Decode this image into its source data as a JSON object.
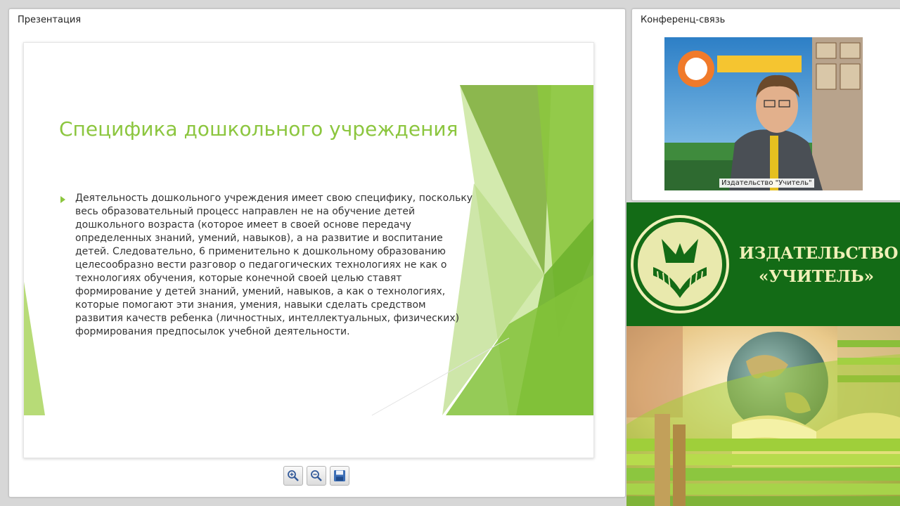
{
  "presentation_panel": {
    "title": "Презентация",
    "slide": {
      "title": "Специфика дошкольного учреждения",
      "body": "Деятельность дошкольного учреждения имеет свою специфику, поскольку весь образовательный процесс направлен не на обучение детей дошкольного возраста (которое имеет в своей основе передачу определенных знаний, умений, навыков), а на развитие и воспитание детей. Следовательно, 6 применительно к дошкольному образованию целесообразно вести разговор о педагогических технологиях не как о технологиях обучения, которые конечной своей целью ставят формирование у детей знаний, умений, навыков, а как о технологиях, которые помогают эти знания, умения, навыки сделать средством развития качеств ребенка (личностных, интеллектуальных, физических) формирования предпосылок учебной деятельности."
    },
    "toolbar": {
      "zoom_in_icon": "zoom-in-icon",
      "zoom_out_icon": "zoom-out-icon",
      "save_icon": "floppy-disk-icon"
    }
  },
  "conference_panel": {
    "title": "Конференц-связь",
    "video_caption": "Издательство \"Учитель\""
  },
  "publisher_banner": {
    "name_line1": "ИЗДАТЕЛЬСТВО",
    "name_line2": "«УЧИТЕЛЬ»"
  },
  "colors": {
    "slide_accent": "#8cc63f",
    "banner_green": "#136b16",
    "banner_text": "#f0f0b8"
  }
}
